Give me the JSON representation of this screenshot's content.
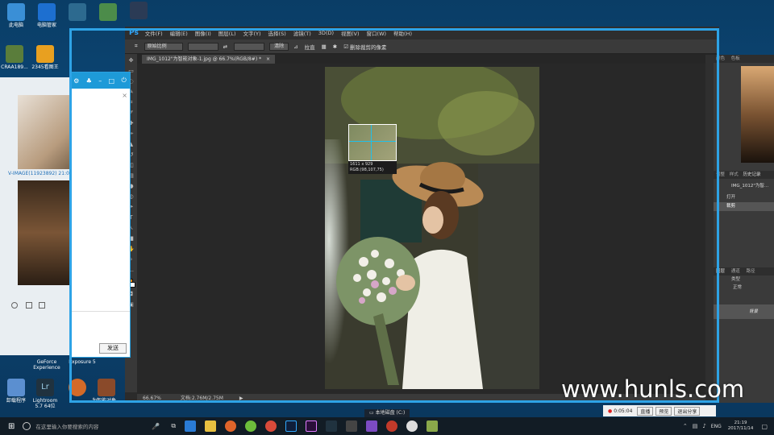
{
  "desktop": {
    "icons_row1": [
      "此电脑",
      "电脑管家",
      "",
      "",
      ""
    ],
    "icons_row2": [
      "CRAA189...",
      "2345看图王",
      "闪电助手",
      "McAfee Securi..."
    ],
    "icons_bottom": [
      "GeForce Experience",
      "Exposure 5",
      "强力..."
    ],
    "icons_bottom2": [
      "卸载程序",
      "Lightroom 5.7 64位",
      "",
      "为智能对象..."
    ]
  },
  "gallery": {
    "caption": "V-IMAGE(11923892) 21:0",
    "time": "08"
  },
  "chat": {
    "send_label": "发送"
  },
  "photoshop": {
    "logo": "Ps",
    "menu": [
      "文件(F)",
      "编辑(E)",
      "图像(I)",
      "图层(L)",
      "文字(Y)",
      "选择(S)",
      "滤镜(T)",
      "3D(D)",
      "视图(V)",
      "窗口(W)",
      "帮助(H)"
    ],
    "options": {
      "ratio_select": "原始比例",
      "clear_label": "清除",
      "straighten_label": "拉直",
      "delete_cropped_label": "删除裁剪的像素"
    },
    "document_tab": "IMG_1012\"为智能对象-1.jpg @ 66.7%(RGB/8#) *",
    "loupe": {
      "size": "1611 x 929",
      "rgb": "RGB:(98,107,75)"
    },
    "status": {
      "zoom": "66.67%",
      "doc": "文档:2.76M/2.75M"
    },
    "panels": {
      "color_tabs": [
        "颜色",
        "色板"
      ],
      "history_tabs": [
        "调整",
        "样式",
        "历史记录"
      ],
      "history_items": [
        "IMG_1012\"为智...",
        "打开",
        "裁剪"
      ],
      "layers_tabs": [
        "图层",
        "通道",
        "路径"
      ],
      "layer_kind": "类型",
      "blend_mode": "正常",
      "layer_name": "背景"
    }
  },
  "taskbar": {
    "search_placeholder": "在这里输入你要搜索的内容",
    "timer": "0:05:04",
    "btn_live": "直播",
    "btn_preview": "预览",
    "btn_share": "退出分享",
    "lang": "ENG",
    "time": "21:19",
    "date": "2017/11/14"
  },
  "explorer": {
    "item": "本地磁盘 (C:)"
  },
  "watermark": "www.hunls.com",
  "colors": {
    "ps_accent": "#31a8ff",
    "frame": "#2ea3e6",
    "taskbar": "#121c25"
  }
}
